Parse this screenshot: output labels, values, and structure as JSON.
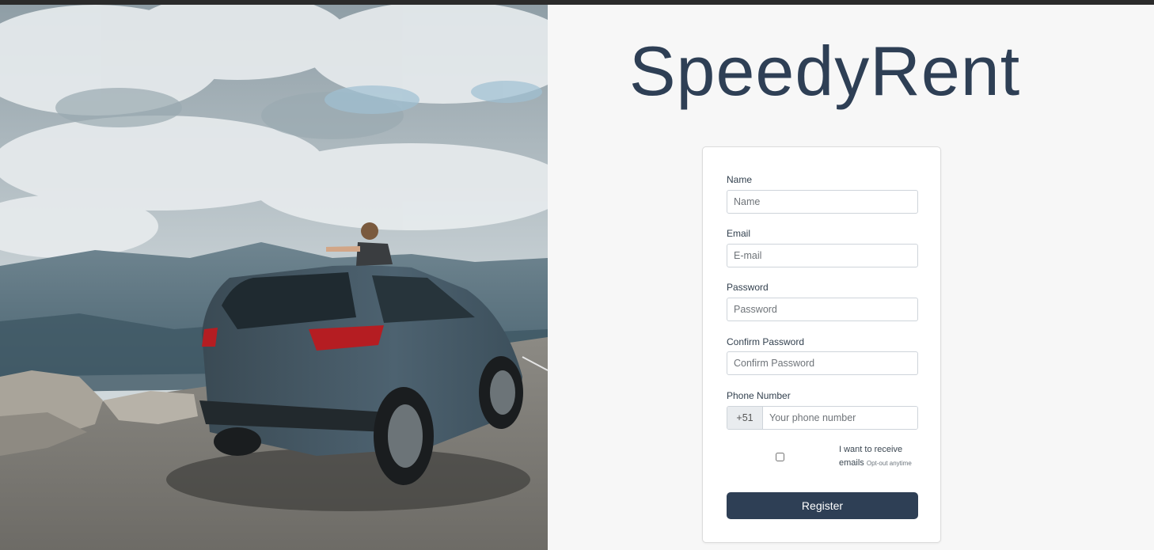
{
  "brand": {
    "title": "SpeedyRent"
  },
  "form": {
    "name": {
      "label": "Name",
      "placeholder": "Name"
    },
    "email": {
      "label": "Email",
      "placeholder": "E-mail"
    },
    "password": {
      "label": "Password",
      "placeholder": "Password"
    },
    "confirm_password": {
      "label": "Confirm Password",
      "placeholder": "Confirm Password"
    },
    "phone": {
      "label": "Phone Number",
      "prefix": "+51",
      "placeholder": "Your phone number"
    },
    "optin": {
      "text": "I want to receive emails",
      "small": "Opt-out anytime",
      "checked": false
    },
    "submit_label": "Register"
  },
  "colors": {
    "brand": "#2e3f55",
    "button": "#2e3f55",
    "background": "#f7f7f7"
  }
}
